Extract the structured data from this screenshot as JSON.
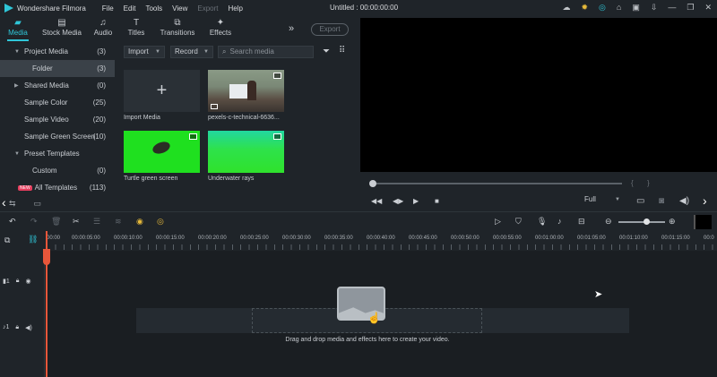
{
  "app": {
    "name": "Wondershare Filmora",
    "document_title": "Untitled : 00:00:00:00"
  },
  "menu": [
    "File",
    "Edit",
    "Tools",
    "View",
    "Export",
    "Help"
  ],
  "tabs": [
    {
      "label": "Media",
      "icon": "folder-icon"
    },
    {
      "label": "Stock Media",
      "icon": "stock-icon"
    },
    {
      "label": "Audio",
      "icon": "music-note-icon"
    },
    {
      "label": "Titles",
      "icon": "text-icon"
    },
    {
      "label": "Transitions",
      "icon": "transition-icon"
    },
    {
      "label": "Effects",
      "icon": "sparkle-icon"
    }
  ],
  "export_label": "Export",
  "sidebar": {
    "items": [
      {
        "label": "Project Media",
        "count": "(3)"
      },
      {
        "label": "Folder",
        "count": "(3)"
      },
      {
        "label": "Shared Media",
        "count": "(0)"
      },
      {
        "label": "Sample Color",
        "count": "(25)"
      },
      {
        "label": "Sample Video",
        "count": "(20)"
      },
      {
        "label": "Sample Green Screen",
        "count": "(10)"
      },
      {
        "label": "Preset Templates",
        "count": ""
      },
      {
        "label": "Custom",
        "count": "(0)"
      },
      {
        "label": "All Templates",
        "count": "(113)",
        "badge": "NEW"
      }
    ]
  },
  "media_toolbar": {
    "import_label": "Import",
    "record_label": "Record",
    "search_placeholder": "Search media"
  },
  "media": [
    {
      "label": "Import Media",
      "type": "import"
    },
    {
      "label": "pexels-c-technical-6636...",
      "type": "video"
    },
    {
      "label": "Turtle green screen",
      "type": "video"
    },
    {
      "label": "Underwater rays",
      "type": "video"
    }
  ],
  "preview": {
    "quality": "Full"
  },
  "ruler": [
    "00:00",
    "00:00:05:00",
    "00:00:10:00",
    "00:00:15:00",
    "00:00:20:00",
    "00:00:25:00",
    "00:00:30:00",
    "00:00:35:00",
    "00:00:40:00",
    "00:00:45:00",
    "00:00:50:00",
    "00:00:55:00",
    "00:01:00:00",
    "00:01:05:00",
    "00:01:10:00",
    "00:01:15:00",
    "00:0"
  ],
  "tracks": [
    {
      "label": "1"
    },
    {
      "label": "1"
    }
  ],
  "drop_text": "Drag and drop media and effects here to create your video.",
  "colors": {
    "accent": "#2fc6d8",
    "playhead": "#e8563a",
    "green_screen": "#1fe01f"
  }
}
